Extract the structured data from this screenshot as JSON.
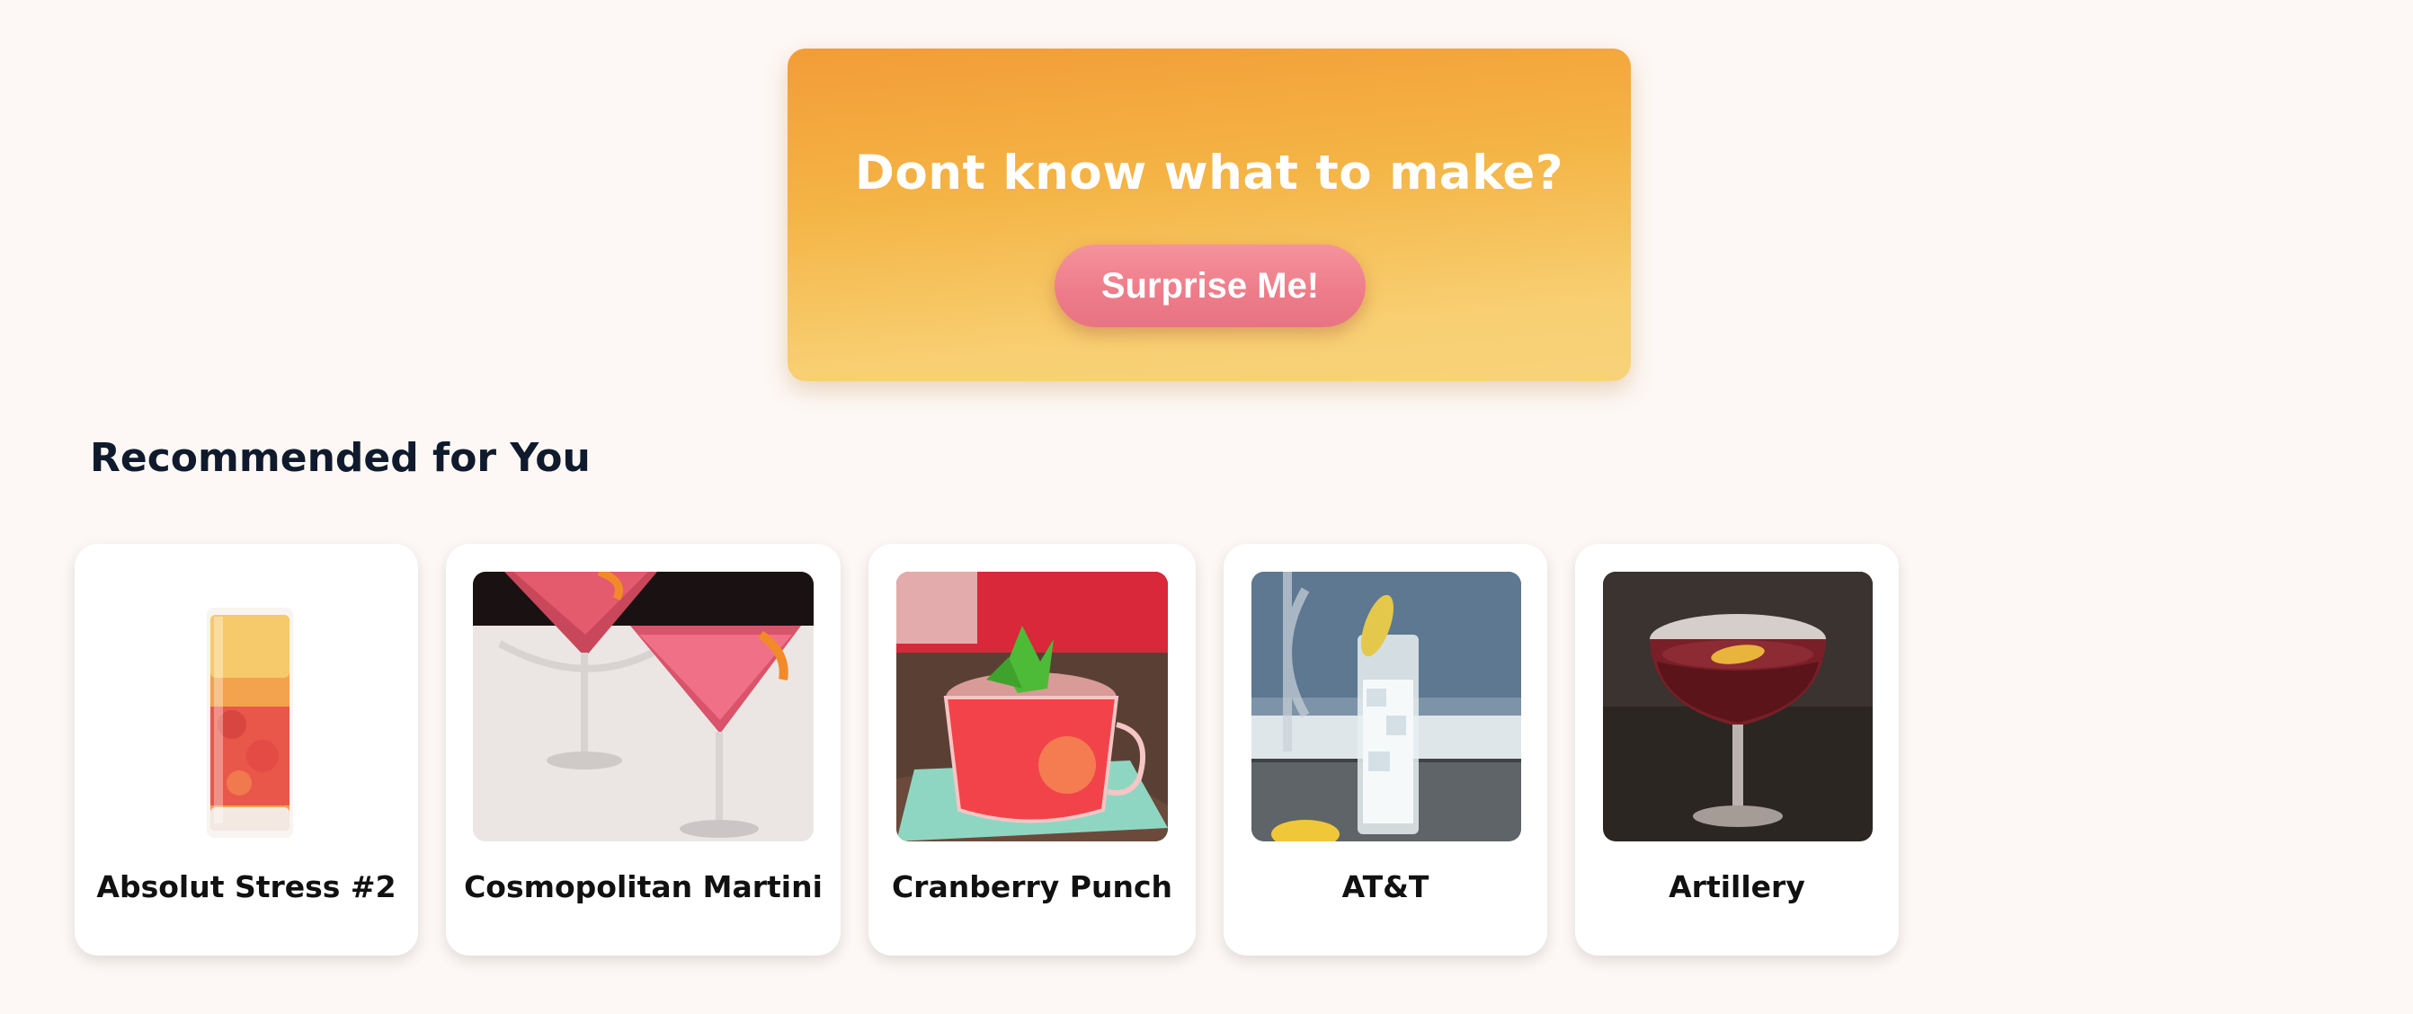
{
  "hero": {
    "title": "Dont know what to make?",
    "button_label": "Surprise Me!"
  },
  "recommended": {
    "heading": "Recommended for You",
    "cards": [
      {
        "name": "Absolut Stress #2",
        "image": "tall-glass-orange-red-drink"
      },
      {
        "name": "Cosmopolitan Martini",
        "image": "two-martini-glasses-pink"
      },
      {
        "name": "Cranberry Punch",
        "image": "red-punch-mug-with-mint"
      },
      {
        "name": "AT&T",
        "image": "clear-highball-with-lime"
      },
      {
        "name": "Artillery",
        "image": "coupe-glass-dark-red-with-twist"
      }
    ]
  },
  "colors": {
    "background": "#fdf8f5",
    "hero_orange": "#f39c38",
    "hero_yellow": "#f8d27a",
    "button_pink": "#ee7b89"
  }
}
